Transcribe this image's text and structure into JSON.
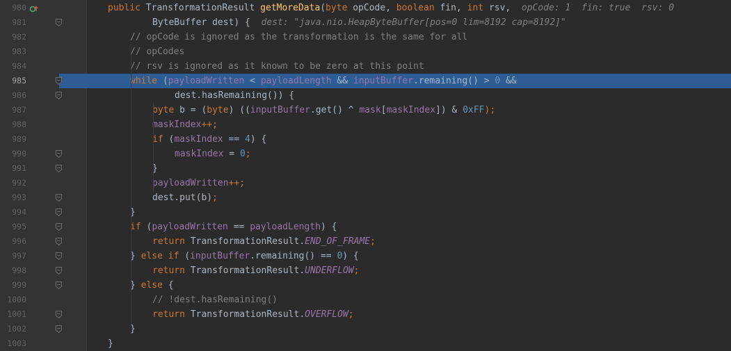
{
  "editor": {
    "lines": [
      {
        "num": "980",
        "indent": 1,
        "tokens": [
          {
            "t": "public ",
            "c": "kw"
          },
          {
            "t": "TransformationResult ",
            "c": ""
          },
          {
            "t": "getMoreData",
            "c": "mth"
          },
          {
            "t": "(",
            "c": ""
          },
          {
            "t": "byte ",
            "c": "kw"
          },
          {
            "t": "opCode, ",
            "c": ""
          },
          {
            "t": "boolean ",
            "c": "kw"
          },
          {
            "t": "fin, ",
            "c": ""
          },
          {
            "t": "int ",
            "c": "kw"
          },
          {
            "t": "rsv,  ",
            "c": ""
          },
          {
            "t": "opCode: 1  fin: true  rsv: 0",
            "c": "hint"
          }
        ],
        "marker": true
      },
      {
        "num": "981",
        "indent": 3,
        "tokens": [
          {
            "t": "ByteBuffer dest) {  ",
            "c": ""
          },
          {
            "t": "dest: \"java.nio.HeapByteBuffer[pos=0 lim=8192 cap=8192]\"",
            "c": "hint"
          }
        ]
      },
      {
        "num": "982",
        "indent": 2,
        "tokens": [
          {
            "t": "// opCode is ignored as the transformation is the same for all",
            "c": "cmt"
          }
        ]
      },
      {
        "num": "983",
        "indent": 2,
        "tokens": [
          {
            "t": "// opCodes",
            "c": "cmt"
          }
        ]
      },
      {
        "num": "984",
        "indent": 2,
        "tokens": [
          {
            "t": "// rsv is ignored as it known to be zero at this point",
            "c": "cmt"
          }
        ]
      },
      {
        "num": "985",
        "indent": 2,
        "current": true,
        "tokens": [
          {
            "t": "while ",
            "c": "kw"
          },
          {
            "t": "(",
            "c": ""
          },
          {
            "t": "payloadWritten",
            "c": "fld"
          },
          {
            "t": " < ",
            "c": ""
          },
          {
            "t": "payloadLength",
            "c": "fld"
          },
          {
            "t": " && ",
            "c": ""
          },
          {
            "t": "inputBuffer",
            "c": "fld"
          },
          {
            "t": ".remaining() > ",
            "c": ""
          },
          {
            "t": "0",
            "c": "num"
          },
          {
            "t": " &&",
            "c": ""
          }
        ]
      },
      {
        "num": "986",
        "indent": 4,
        "tokens": [
          {
            "t": "dest.hasRemaining()) {",
            "c": ""
          }
        ]
      },
      {
        "num": "987",
        "indent": 3,
        "tokens": [
          {
            "t": "byte ",
            "c": "kw"
          },
          {
            "t": "b = (",
            "c": ""
          },
          {
            "t": "byte",
            "c": "kw"
          },
          {
            "t": ") ((",
            "c": ""
          },
          {
            "t": "inputBuffer",
            "c": "fld"
          },
          {
            "t": ".get() ^ ",
            "c": ""
          },
          {
            "t": "mask",
            "c": "fld"
          },
          {
            "t": "[",
            "c": ""
          },
          {
            "t": "maskIndex",
            "c": "fld"
          },
          {
            "t": "]) & ",
            "c": ""
          },
          {
            "t": "0xFF",
            "c": "num"
          },
          {
            "t": ");",
            "c": "kw"
          }
        ]
      },
      {
        "num": "988",
        "indent": 3,
        "tokens": [
          {
            "t": "maskIndex",
            "c": "fld"
          },
          {
            "t": "++;",
            "c": "kw"
          }
        ]
      },
      {
        "num": "989",
        "indent": 3,
        "tokens": [
          {
            "t": "if ",
            "c": "kw"
          },
          {
            "t": "(",
            "c": ""
          },
          {
            "t": "maskIndex",
            "c": "fld"
          },
          {
            "t": " == ",
            "c": ""
          },
          {
            "t": "4",
            "c": "num"
          },
          {
            "t": ") {",
            "c": ""
          }
        ]
      },
      {
        "num": "990",
        "indent": 4,
        "tokens": [
          {
            "t": "maskIndex",
            "c": "fld"
          },
          {
            "t": " = ",
            "c": ""
          },
          {
            "t": "0",
            "c": "num"
          },
          {
            "t": ";",
            "c": "kw"
          }
        ]
      },
      {
        "num": "991",
        "indent": 3,
        "tokens": [
          {
            "t": "}",
            "c": ""
          }
        ]
      },
      {
        "num": "992",
        "indent": 3,
        "tokens": [
          {
            "t": "payloadWritten",
            "c": "fld"
          },
          {
            "t": "++;",
            "c": "kw"
          }
        ]
      },
      {
        "num": "993",
        "indent": 3,
        "tokens": [
          {
            "t": "dest.put(b)",
            "c": ""
          },
          {
            "t": ";",
            "c": "kw"
          }
        ]
      },
      {
        "num": "994",
        "indent": 2,
        "tokens": [
          {
            "t": "}",
            "c": ""
          }
        ]
      },
      {
        "num": "995",
        "indent": 2,
        "tokens": [
          {
            "t": "if ",
            "c": "kw"
          },
          {
            "t": "(",
            "c": ""
          },
          {
            "t": "payloadWritten",
            "c": "fld"
          },
          {
            "t": " == ",
            "c": ""
          },
          {
            "t": "payloadLength",
            "c": "fld"
          },
          {
            "t": ") {",
            "c": ""
          }
        ]
      },
      {
        "num": "996",
        "indent": 3,
        "tokens": [
          {
            "t": "return ",
            "c": "kw"
          },
          {
            "t": "TransformationResult.",
            "c": ""
          },
          {
            "t": "END_OF_FRAME",
            "c": "fld ital"
          },
          {
            "t": ";",
            "c": "kw"
          }
        ]
      },
      {
        "num": "997",
        "indent": 2,
        "tokens": [
          {
            "t": "} ",
            "c": ""
          },
          {
            "t": "else if ",
            "c": "kw"
          },
          {
            "t": "(",
            "c": ""
          },
          {
            "t": "inputBuffer",
            "c": "fld"
          },
          {
            "t": ".remaining() == ",
            "c": ""
          },
          {
            "t": "0",
            "c": "num"
          },
          {
            "t": ") {",
            "c": ""
          }
        ]
      },
      {
        "num": "998",
        "indent": 3,
        "tokens": [
          {
            "t": "return ",
            "c": "kw"
          },
          {
            "t": "TransformationResult.",
            "c": ""
          },
          {
            "t": "UNDERFLOW",
            "c": "fld ital"
          },
          {
            "t": ";",
            "c": "kw"
          }
        ]
      },
      {
        "num": "999",
        "indent": 2,
        "tokens": [
          {
            "t": "} ",
            "c": ""
          },
          {
            "t": "else ",
            "c": "kw"
          },
          {
            "t": "{",
            "c": ""
          }
        ]
      },
      {
        "num": "1000",
        "indent": 3,
        "tokens": [
          {
            "t": "// !dest.hasRemaining()",
            "c": "cmt"
          }
        ]
      },
      {
        "num": "1001",
        "indent": 3,
        "tokens": [
          {
            "t": "return ",
            "c": "kw"
          },
          {
            "t": "TransformationResult.",
            "c": ""
          },
          {
            "t": "OVERFLOW",
            "c": "fld ital"
          },
          {
            "t": ";",
            "c": "kw"
          }
        ]
      },
      {
        "num": "1002",
        "indent": 2,
        "tokens": [
          {
            "t": "}",
            "c": ""
          }
        ]
      },
      {
        "num": "1003",
        "indent": 1,
        "tokens": [
          {
            "t": "}",
            "c": ""
          }
        ]
      }
    ],
    "colors": {
      "background": "#2b2b2b",
      "gutter": "#313335",
      "current_line": "#2d5d94",
      "keyword": "#cc7832",
      "field": "#9876aa",
      "number": "#6897bb",
      "comment": "#808080",
      "method": "#ffc66d",
      "text": "#a9b7c6"
    },
    "icons": {
      "breakpoint_marker": "override-method-icon",
      "fold": "fold-marker-icon"
    }
  }
}
